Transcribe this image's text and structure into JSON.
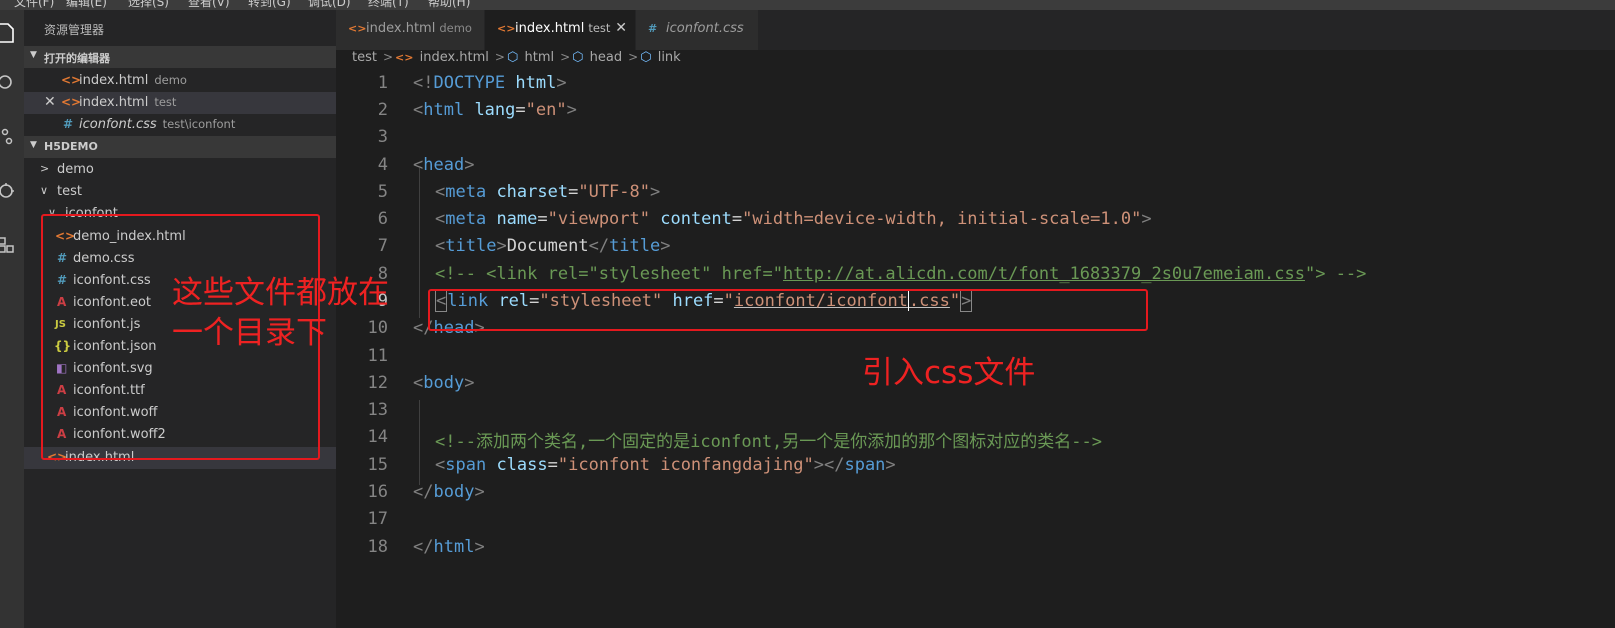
{
  "menubar": [
    "文件(F)",
    "编辑(E)",
    "选择(S)",
    "查看(V)",
    "转到(G)",
    "调试(D)",
    "终端(T)",
    "帮助(H)"
  ],
  "icons": [
    "files-icon",
    "search-icon",
    "source-control-icon",
    "debug-icon",
    "extensions-icon"
  ],
  "sidebar": {
    "title": "资源管理器",
    "open_editors": {
      "header": "打开的编辑器",
      "items": [
        {
          "icon": "<>",
          "name": "index.html",
          "desc": "demo"
        },
        {
          "icon": "<>",
          "name": "index.html",
          "desc": "test",
          "close": "✕"
        },
        {
          "icon": "#",
          "name": "iconfont.css",
          "desc": "test\\iconfont"
        }
      ]
    },
    "project": {
      "header": "H5DEMO",
      "folders": {
        "demo": "demo",
        "test": "test",
        "iconfont": "iconfont"
      },
      "files": [
        {
          "icon": "<>",
          "name": "demo_index.html"
        },
        {
          "icon": "#",
          "name": "demo.css"
        },
        {
          "icon": "#",
          "name": "iconfont.css"
        },
        {
          "icon": "A",
          "name": "iconfont.eot"
        },
        {
          "icon": "JS",
          "name": "iconfont.js"
        },
        {
          "icon": "{}",
          "name": "iconfont.json"
        },
        {
          "icon": "◧",
          "name": "iconfont.svg"
        },
        {
          "icon": "A",
          "name": "iconfont.ttf"
        },
        {
          "icon": "A",
          "name": "iconfont.woff"
        },
        {
          "icon": "A",
          "name": "iconfont.woff2"
        }
      ],
      "root_file": {
        "icon": "<>",
        "name": "index.html"
      }
    }
  },
  "tabs": [
    {
      "icon": "<>",
      "name": "index.html",
      "desc": "demo"
    },
    {
      "icon": "<>",
      "name": "index.html",
      "desc": "test",
      "close": "✕"
    },
    {
      "icon": "#",
      "name": "iconfont.css",
      "desc": ""
    }
  ],
  "breadcrumb": [
    "test",
    "index.html",
    "html",
    "head",
    "link"
  ],
  "line_numbers": [
    "1",
    "2",
    "3",
    "4",
    "5",
    "6",
    "7",
    "8",
    "9",
    "10",
    "11",
    "12",
    "13",
    "14",
    "15",
    "16",
    "17",
    "18"
  ],
  "code": {
    "l1": [
      "<!",
      "DOCTYPE",
      " html",
      ">"
    ],
    "l2": [
      "<",
      "html",
      " lang",
      "=",
      "\"en\"",
      ">"
    ],
    "l4": [
      "<",
      "head",
      ">"
    ],
    "l5": [
      "<",
      "meta",
      " charset",
      "=",
      "\"UTF-8\"",
      ">"
    ],
    "l6": [
      "<",
      "meta",
      " name",
      "=",
      "\"viewport\"",
      " content",
      "=",
      "\"width=device-width, initial-scale=1.0\"",
      ">"
    ],
    "l7": [
      "<",
      "title",
      ">",
      "Document",
      "</",
      "title",
      ">"
    ],
    "l8": [
      "<!-- <link rel=\"stylesheet\" href=\"",
      "http://at.alicdn.com/t/font_1683379_2s0u7emeiam.css",
      "\"> -->"
    ],
    "l9": [
      "<",
      "link",
      " rel",
      "=",
      "\"stylesheet\"",
      " href",
      "=",
      "\"",
      "iconfont/iconfont",
      ".css",
      "\"",
      ">"
    ],
    "l10": [
      "</",
      "head",
      ">"
    ],
    "l12": [
      "<",
      "body",
      ">"
    ],
    "l14": [
      "<!--添加两个类名,一个固定的是iconfont,另一个是你添加的那个图标对应的类名-->"
    ],
    "l15": [
      "<",
      "span",
      " class",
      "=",
      "\"iconfont iconfangdajing\"",
      "></",
      "span",
      ">"
    ],
    "l16": [
      "</",
      "body",
      ">"
    ],
    "l18": [
      "</",
      "html",
      ">"
    ]
  },
  "annotations": {
    "folder_note_line1": "这些文件都放在",
    "folder_note_line2": "一个目录下",
    "link_note": "引入css文件"
  }
}
